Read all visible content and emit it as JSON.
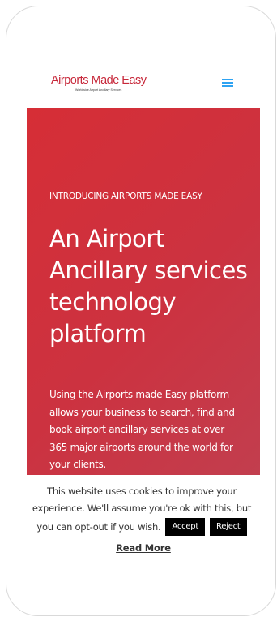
{
  "header": {
    "logo_text": "Airports Made Easy",
    "logo_tagline": "Worldwide Airport Ancillary Services",
    "menu_icon": "hamburger-menu-icon"
  },
  "hero": {
    "eyebrow": "INTRODUCING AIRPORTS MADE EASY",
    "title": "An Airport Ancillary services technology platform",
    "body": "Using the Airports made Easy platform allows your business to search, find and book airport ancillary services at over 365 major airports around the world for your clients."
  },
  "cookie_notice": {
    "line1": "This website uses cookies to improve your",
    "line2": "experience. We'll assume you're ok with this, but",
    "line3": "you can opt-out if you wish.",
    "accept_label": "Accept",
    "reject_label": "Reject",
    "read_more_label": "Read More"
  },
  "colors": {
    "brand_red": "#c7283a",
    "hero_background": "#d62e36",
    "menu_icon": "#2ea3f2",
    "button_background": "#000000"
  }
}
